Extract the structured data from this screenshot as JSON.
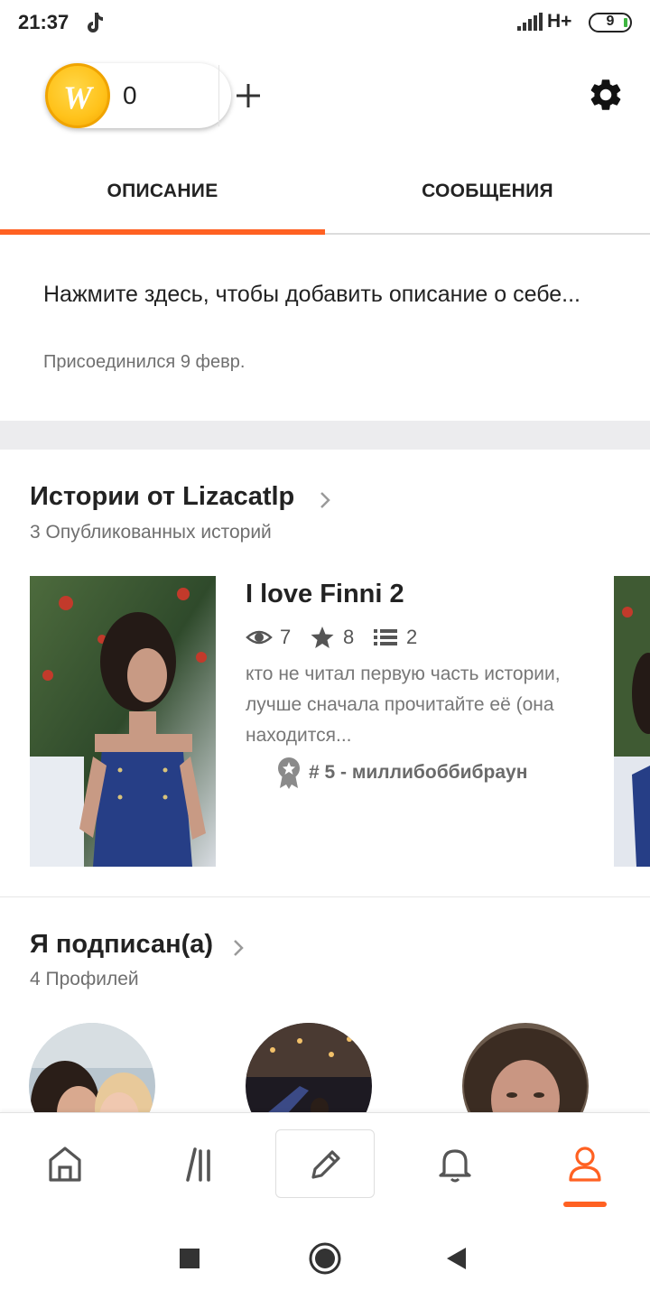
{
  "status_bar": {
    "time": "21:37",
    "network": "H+",
    "battery": "9",
    "icons": [
      "tiktok-note-icon",
      "signal-icon",
      "battery-icon"
    ]
  },
  "header": {
    "coin_count": "0",
    "coin_letter": "W",
    "icons": [
      "coin-icon",
      "plus-icon",
      "gear-icon"
    ]
  },
  "tabs": [
    {
      "label": "ОПИСАНИЕ",
      "active": true
    },
    {
      "label": "СООБЩЕНИЯ",
      "active": false
    }
  ],
  "about": {
    "description": "Нажмите здесь, чтобы добавить описание о себе...",
    "joined": "Присоединился 9 февр."
  },
  "stories": {
    "title": "Истории от Lizacatlp",
    "subtitle": "3 Опубликованных историй",
    "item": {
      "title": "I love Finni 2",
      "reads": "7",
      "votes": "8",
      "parts": "2",
      "blurb": "кто не читал первую часть истории, лучше сначала прочитайте её (она находится...",
      "rank": "# 5 - миллибоббибраун"
    }
  },
  "following": {
    "title": "Я подписан(а)",
    "subtitle": "4 Профилей"
  },
  "bottom_nav": [
    "home-icon",
    "library-icon",
    "write-icon",
    "bell-icon",
    "profile-icon"
  ],
  "colors": {
    "accent": "#ff6122",
    "coin": "#ffc21a",
    "text": "#222222",
    "muted": "#6f6f6f"
  }
}
